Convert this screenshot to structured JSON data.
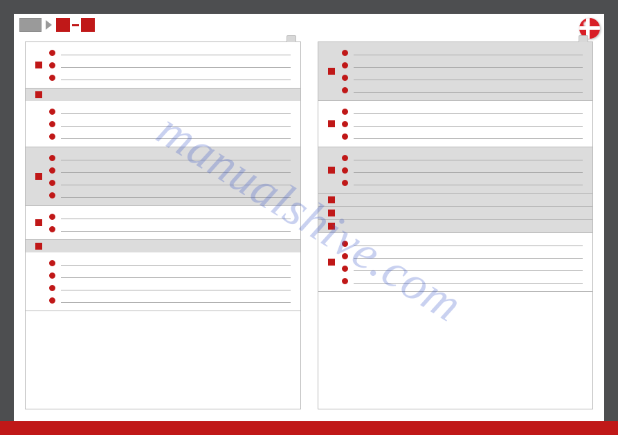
{
  "watermark": "manualshive.com",
  "flag": {
    "country": "denmark",
    "color": "#d81e26"
  },
  "left_column": {
    "sections": [
      {
        "header": false,
        "bg": "white",
        "bullets": 3,
        "square": true
      },
      {
        "header": true,
        "bg": "white",
        "bullets": 3,
        "square": true
      },
      {
        "header": false,
        "bg": "gray",
        "bullets": 4,
        "square": true
      },
      {
        "header": false,
        "bg": "white",
        "bullets": 2,
        "square": true
      },
      {
        "header": true,
        "bg": "white",
        "bullets": 4,
        "square": true
      }
    ]
  },
  "right_column": {
    "sections": [
      {
        "header": false,
        "bg": "gray",
        "bullets": 4,
        "square": true
      },
      {
        "header": false,
        "bg": "white",
        "bullets": 3,
        "square": true
      },
      {
        "header": false,
        "bg": "gray",
        "bullets": 3,
        "square": true
      },
      {
        "header": true,
        "bg": "white",
        "bullets": 0,
        "square": false
      },
      {
        "header": true,
        "bg": "white",
        "bullets": 0,
        "square": false
      },
      {
        "header": true,
        "bg": "white",
        "bullets": 0,
        "square": false
      },
      {
        "header": false,
        "bg": "white",
        "bullets": 4,
        "square": true
      }
    ]
  }
}
